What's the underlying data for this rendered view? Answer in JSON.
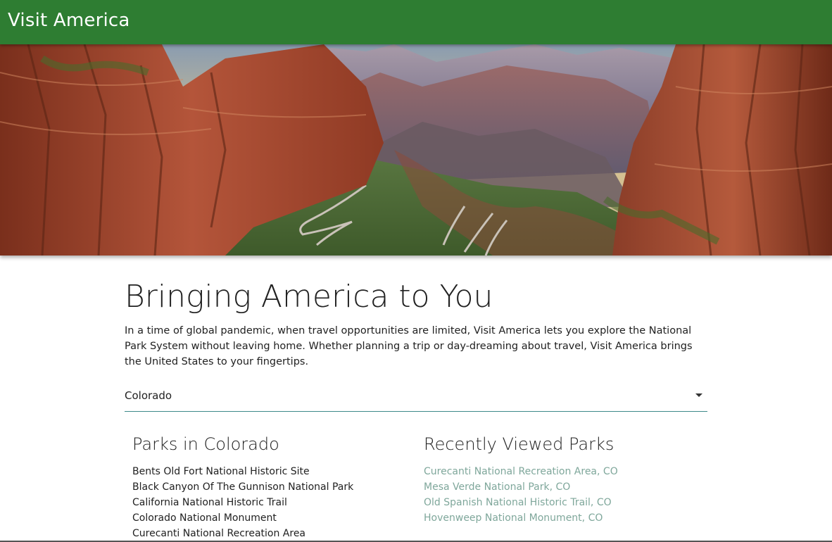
{
  "app_bar": {
    "title": "Visit America",
    "color": "#2e7d32"
  },
  "hero": {
    "image": "zion-canyon-landscape"
  },
  "main": {
    "headline": "Bringing America to You",
    "intro": "In a time of global pandemic, when travel opportunities are limited, Visit America lets you explore the National Park System without leaving home. Whether planning a trip or day-dreaming about travel, Visit America brings the United States to your fingertips.",
    "state_select": {
      "value": "Colorado",
      "icon": "arrow-drop-down-icon"
    },
    "parks_section": {
      "title": "Parks in Colorado",
      "items": [
        "Bents Old Fort National Historic Site",
        "Black Canyon Of The Gunnison National Park",
        "California National Historic Trail",
        "Colorado National Monument",
        "Curecanti National Recreation Area"
      ]
    },
    "recent_section": {
      "title": "Recently Viewed Parks",
      "link_color": "#7fa79b",
      "items": [
        "Curecanti National Recreation Area, CO",
        "Mesa Verde National Park, CO",
        "Old Spanish National Historic Trail, CO",
        "Hovenweep National Monument, CO"
      ]
    }
  }
}
